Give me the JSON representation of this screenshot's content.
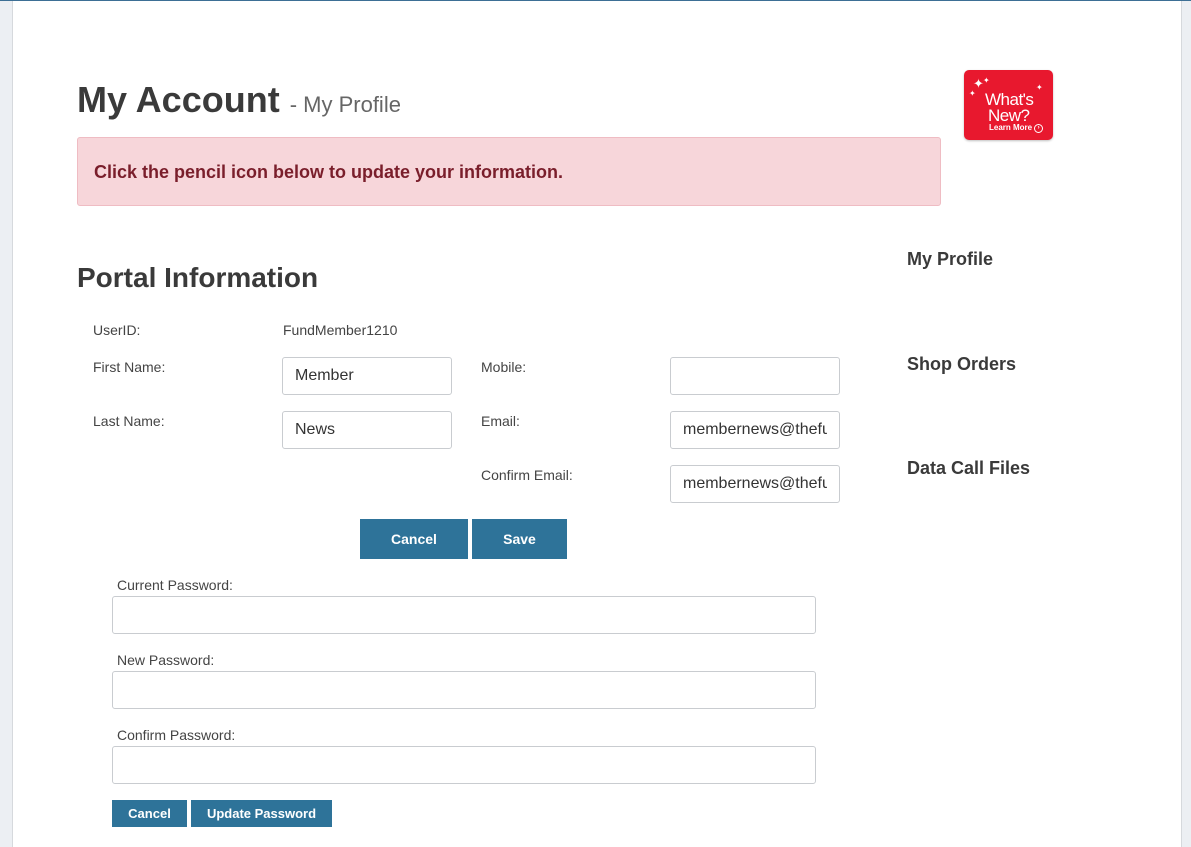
{
  "header": {
    "title": "My Account",
    "subtitle": "- My Profile"
  },
  "whats_new": {
    "line1": "What's",
    "line2": "New?",
    "link": "Learn More",
    "color": "#e8182e"
  },
  "alert": {
    "message": "Click the pencil icon below to update your information."
  },
  "section": {
    "title": "Portal Information"
  },
  "form": {
    "userid_label": "UserID:",
    "userid_value": "FundMember1210",
    "first_name_label": "First Name:",
    "first_name_value": "Member",
    "last_name_label": "Last Name:",
    "last_name_value": "News",
    "mobile_label": "Mobile:",
    "mobile_value": "",
    "email_label": "Email:",
    "email_value": "membernews@thefund",
    "confirm_email_label": "Confirm Email:",
    "confirm_email_value": "membernews@thefund",
    "cancel_label": "Cancel",
    "save_label": "Save"
  },
  "password": {
    "current_label": "Current Password:",
    "new_label": "New Password:",
    "confirm_label": "Confirm Password:",
    "cancel_label": "Cancel",
    "update_label": "Update Password"
  },
  "sidebar": {
    "items": [
      {
        "label": "My Profile"
      },
      {
        "label": "Shop Orders"
      },
      {
        "label": "Data Call Files"
      }
    ]
  },
  "colors": {
    "accent": "#2e7399",
    "alert_bg": "#f7d6da",
    "alert_text": "#7a1e2b"
  }
}
